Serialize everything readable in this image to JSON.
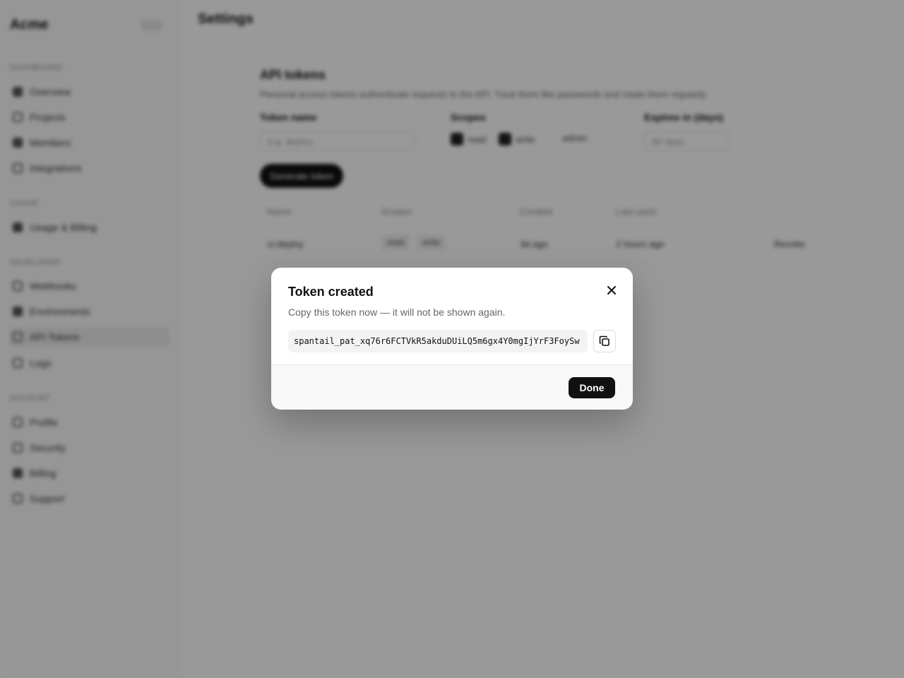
{
  "app": {
    "logo": "Acme",
    "sidebar": {
      "sections": [
        {
          "label": "Dashboard",
          "items": [
            "Overview",
            "Projects",
            "Members",
            "Integrations"
          ]
        },
        {
          "label": "Usage",
          "items": [
            "Usage & Billing"
          ]
        },
        {
          "label": "Developer",
          "items": [
            "Webhooks",
            "Environments",
            "API Tokens",
            "Logs"
          ]
        },
        {
          "label": "Account",
          "items": [
            "Profile",
            "Security",
            "Billing",
            "Support"
          ]
        }
      ]
    },
    "page_title": "Settings",
    "section": {
      "title": "API tokens",
      "description": "Personal access tokens authenticate requests to the API. Treat them like passwords and rotate them regularly.",
      "name_label": "Token name",
      "name_placeholder": "e.g. deploy",
      "scopes_label": "Scopes",
      "scopes": [
        "read",
        "write"
      ],
      "scope_admin": "admin",
      "expiry_label": "Expires in (days)",
      "expiry_placeholder": "90 days",
      "generate_button": "Generate token"
    },
    "table": {
      "headers": [
        "Name",
        "Scopes",
        "Created",
        "Last used"
      ],
      "row": {
        "name": "ci-deploy",
        "scopes": [
          "read",
          "write"
        ],
        "created": "3d ago",
        "last_used": "2 hours ago",
        "action": "Revoke"
      }
    }
  },
  "modal": {
    "title": "Token created",
    "subtitle": "Copy this token now — it will not be shown again.",
    "token": "spantail_pat_xq76r6FCTVkR5akduDUiLQ5m6gx4Y0mgIjYrF3FoySw",
    "done_label": "Done",
    "close_icon": "close-icon",
    "copy_icon": "copy-icon"
  }
}
